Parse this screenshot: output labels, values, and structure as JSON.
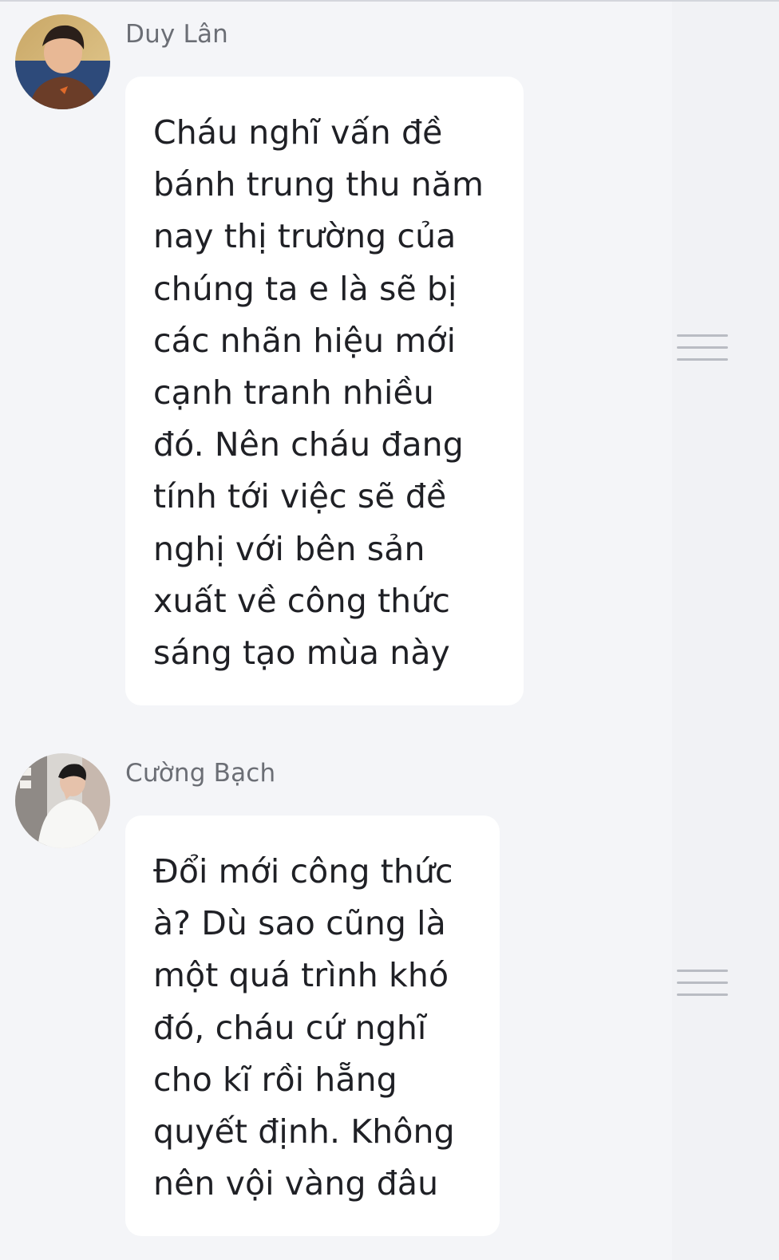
{
  "conversation": {
    "messages": [
      {
        "sender": "Duy Lân",
        "text": "Cháu nghĩ vấn đề\nbánh trung thu năm\nnay thị trường của\nchúng ta e là sẽ bị\ncác nhãn hiệu mới\ncạnh tranh nhiều\nđó. Nên cháu đang\ntính tới việc sẽ đề\nnghị với bên sản\nxuất về công thức\nsáng tạo mùa này",
        "avatar_icon": "avatar-duy-lan",
        "options_icon": "hamburger-menu-icon"
      },
      {
        "sender": "Cường Bạch",
        "text": "Đổi mới công thức\nà? Dù sao cũng là\nmột quá trình khó\nđó, cháu cứ nghĩ\ncho kĩ rồi hẵng\nquyết định. Không\nnên vội vàng đâu",
        "avatar_icon": "avatar-cuong-bach",
        "options_icon": "hamburger-menu-icon"
      }
    ]
  },
  "colors": {
    "background": "#f4f5f8",
    "bubble": "#ffffff",
    "sender_text": "#6b6e75",
    "message_text": "#1f2025",
    "menu_icon": "#b9bcc3"
  }
}
